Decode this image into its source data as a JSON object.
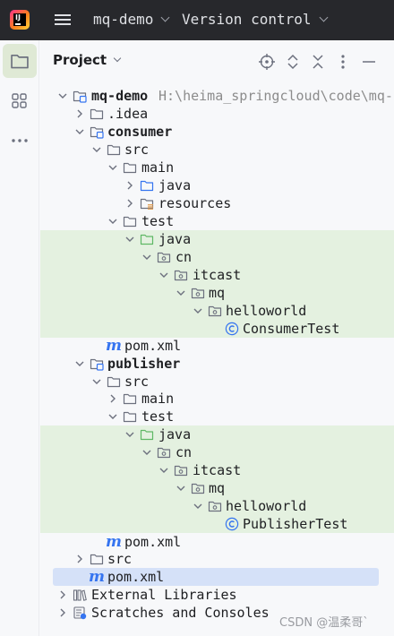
{
  "topbar": {
    "project_name": "mq-demo",
    "vcs_label": "Version control",
    "colors": {
      "background": "#27282c",
      "text": "#dfe1e5"
    }
  },
  "panel": {
    "title": "Project"
  },
  "tree": {
    "root": {
      "label": "mq-demo",
      "path": "H:\\heima_springcloud\\code\\mq-"
    },
    "idea": ".idea",
    "consumer": {
      "label": "consumer",
      "src": "src",
      "main": "main",
      "main_java": "java",
      "resources": "resources",
      "test": "test",
      "test_java": "java",
      "cn": "cn",
      "itcast": "itcast",
      "mq": "mq",
      "helloworld": "helloworld",
      "class": "ConsumerTest",
      "pom": "pom.xml"
    },
    "publisher": {
      "label": "publisher",
      "src": "src",
      "main": "main",
      "test": "test",
      "test_java": "java",
      "cn": "cn",
      "itcast": "itcast",
      "mq": "mq",
      "helloworld": "helloworld",
      "class": "PublisherTest",
      "pom": "pom.xml"
    },
    "src": "src",
    "pom": "pom.xml",
    "external_libraries": "External Libraries",
    "scratches": "Scratches and Consoles"
  },
  "watermark": "CSDN @温柔哥`",
  "colors": {
    "test_highlight": "#e4f1e0",
    "selection": "#d5e1f8",
    "maven_blue": "#3574f0",
    "test_folder_green": "#5fb865"
  }
}
